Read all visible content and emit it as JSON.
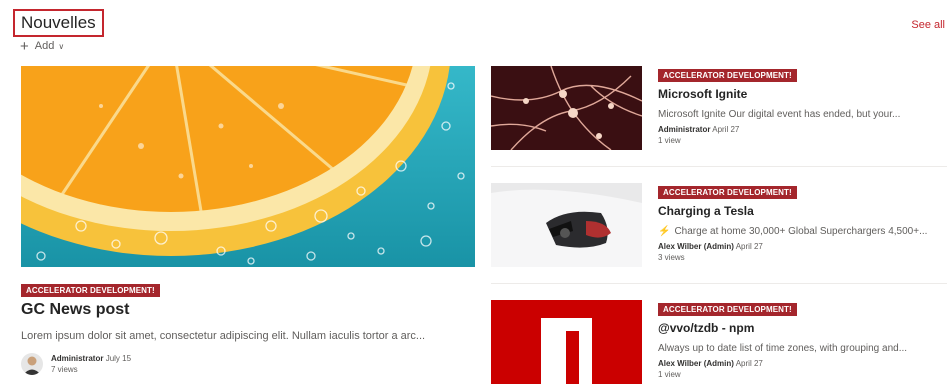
{
  "header": {
    "title": "Nouvelles",
    "see_all": "See all",
    "add_label": "Add"
  },
  "hero": {
    "tag": "ACCELERATOR DEVELOPMENT!",
    "title": "GC News post",
    "description": "Lorem ipsum dolor sit amet, consectetur adipiscing elit. Nullam iaculis tortor a arc...",
    "author": "Administrator",
    "date": "July 15",
    "views": "7 views"
  },
  "items": [
    {
      "tag": "ACCELERATOR DEVELOPMENT!",
      "title": "Microsoft Ignite",
      "description": "Microsoft Ignite Our digital event has ended, but your...",
      "author": "Administrator",
      "date": "April 27",
      "views": "1 view"
    },
    {
      "tag": "ACCELERATOR DEVELOPMENT!",
      "title": "Charging a Tesla",
      "description": "Charge at home 30,000+ Global Superchargers 4,500+...",
      "author": "Alex Wilber (Admin)",
      "date": "April 27",
      "views": "3 views"
    },
    {
      "tag": "ACCELERATOR DEVELOPMENT!",
      "title": "@vvo/tzdb - npm",
      "description": "Always up to date list of time zones, with grouping and...",
      "author": "Alex Wilber (Admin)",
      "date": "April 27",
      "views": "1 view"
    }
  ],
  "colors": {
    "accent": "#c4262e",
    "tag_bg": "#a4262c",
    "npm_red": "#cb0000"
  }
}
